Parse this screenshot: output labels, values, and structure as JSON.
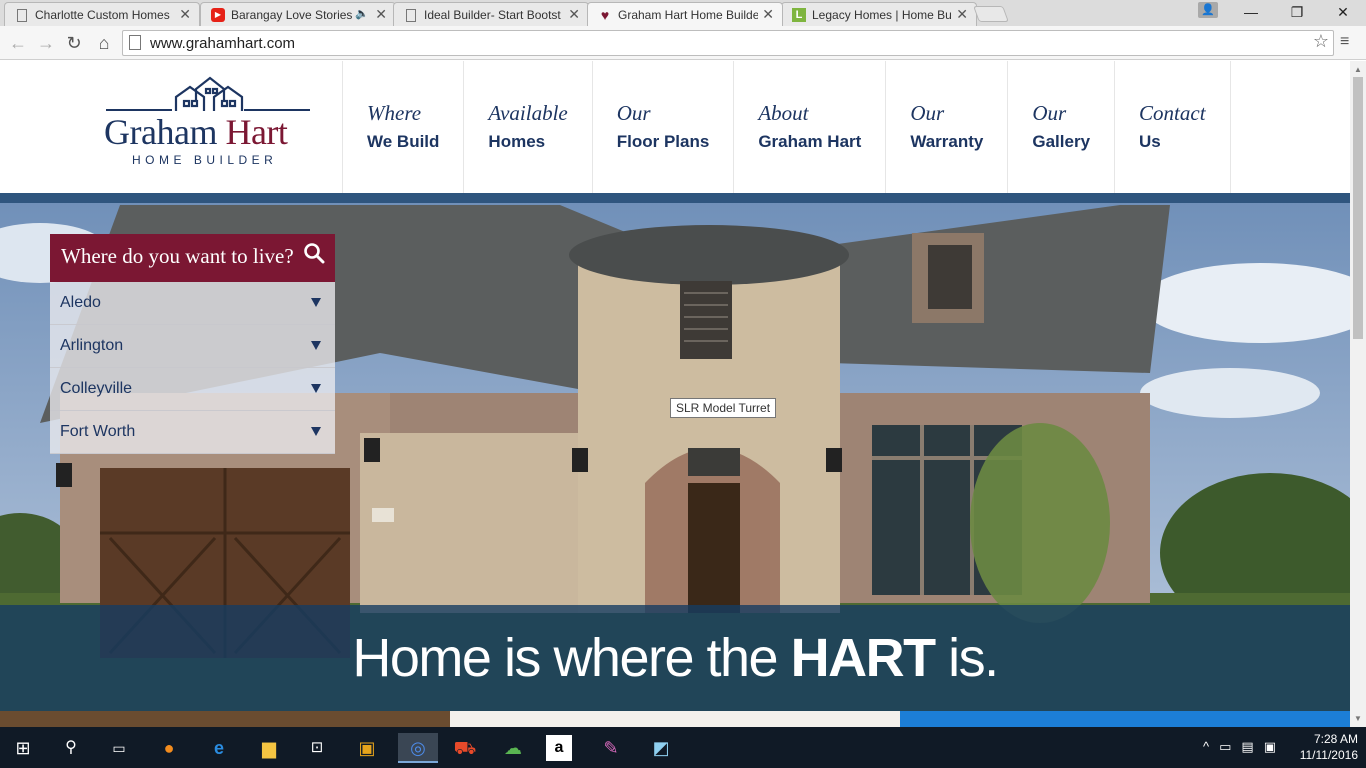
{
  "browser": {
    "tabs": [
      {
        "title": "Charlotte Custom Homes",
        "favicon": "page-icon",
        "active": false
      },
      {
        "title": "Barangay Love Stories",
        "favicon": "youtube-icon",
        "active": false,
        "audio": true
      },
      {
        "title": "Ideal Builder- Start Bootst",
        "favicon": "page-icon",
        "active": false
      },
      {
        "title": "Graham Hart Home Builde",
        "favicon": "heart-icon",
        "active": true
      },
      {
        "title": "Legacy Homes | Home Bu",
        "favicon": "legacy-icon",
        "active": false
      }
    ],
    "url": "www.grahamhart.com"
  },
  "site": {
    "logo": {
      "first": "Graham ",
      "second": "Hart",
      "sub": "HOME BUILDER"
    },
    "nav": [
      {
        "line1": "Where",
        "line2": "We Build"
      },
      {
        "line1": "Available",
        "line2": "Homes"
      },
      {
        "line1": "Our",
        "line2": "Floor Plans"
      },
      {
        "line1": "About",
        "line2": "Graham Hart"
      },
      {
        "line1": "Our",
        "line2": "Warranty"
      },
      {
        "line1": "Our",
        "line2": "Gallery"
      },
      {
        "line1": "Contact",
        "line2": "Us"
      }
    ],
    "search": {
      "question": "Where do you want to live?",
      "locations": [
        "Aledo",
        "Arlington",
        "Colleyville",
        "Fort Worth"
      ]
    },
    "tooltip": "SLR Model Turret",
    "tagline": {
      "pre": "Home is where the ",
      "bold": "HART",
      "post": " is."
    },
    "colors": {
      "navy": "#1d3561",
      "burgundy": "#7b1733",
      "band": "#163c62"
    }
  },
  "taskbar": {
    "time": "7:28 AM",
    "date": "11/11/2016",
    "apps": [
      "windows-icon",
      "search-icon",
      "task-view-icon",
      "firefox-icon",
      "edge-icon",
      "file-explorer-icon",
      "store-icon",
      "notes-icon",
      "chrome-icon",
      "shop-icon",
      "chat-icon",
      "amazon-icon",
      "paint-icon",
      "tablet-icon"
    ]
  }
}
